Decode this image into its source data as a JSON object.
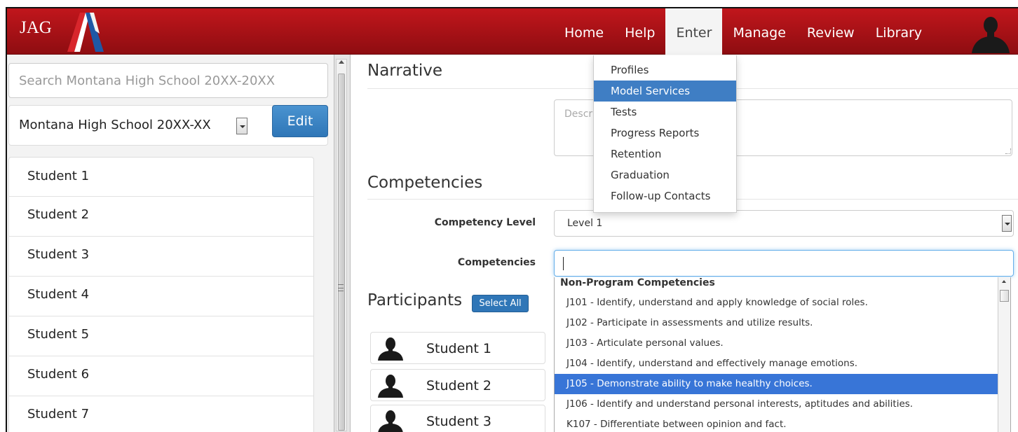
{
  "header": {
    "brand": "JAG",
    "nav": [
      {
        "label": "Home",
        "active": false
      },
      {
        "label": "Help",
        "active": false
      },
      {
        "label": "Enter",
        "active": true
      },
      {
        "label": "Manage",
        "active": false
      },
      {
        "label": "Review",
        "active": false
      },
      {
        "label": "Library",
        "active": false
      }
    ],
    "colors": {
      "bar": "#b3141a",
      "logo_blue": "#1f58a6",
      "logo_red": "#d8262c"
    }
  },
  "enter_menu": {
    "items": [
      {
        "label": "Profiles",
        "active": false
      },
      {
        "label": "Model Services",
        "active": true
      },
      {
        "label": "Tests",
        "active": false
      },
      {
        "label": "Progress Reports",
        "active": false
      },
      {
        "label": "Retention",
        "active": false
      },
      {
        "label": "Graduation",
        "active": false
      },
      {
        "label": "Follow-up Contacts",
        "active": false
      }
    ]
  },
  "left_panel": {
    "search_placeholder": "Search Montana High School 20XX-20XX",
    "school_select": "Montana High School 20XX-XX",
    "edit_label": "Edit",
    "students": [
      "Student 1",
      "Student 2",
      "Student 3",
      "Student 4",
      "Student 5",
      "Student 6",
      "Student 7"
    ]
  },
  "main": {
    "narrative": {
      "title": "Narrative",
      "textarea_placeholder": "Describe the activity"
    },
    "competencies": {
      "title": "Competencies",
      "level_label": "Competency Level",
      "level_value": "Level 1",
      "input_label": "Competencies",
      "input_value": "",
      "dropdown": {
        "group": "Non-Program Competencies",
        "options": [
          {
            "label": "J101 - Identify, understand and apply knowledge of social roles.",
            "highlighted": false
          },
          {
            "label": "J102 - Participate in assessments and utilize results.",
            "highlighted": false
          },
          {
            "label": "J103 - Articulate personal values.",
            "highlighted": false
          },
          {
            "label": "J104 - Identify, understand and effectively manage emotions.",
            "highlighted": false
          },
          {
            "label": "J105 - Demonstrate ability to make healthy choices.",
            "highlighted": true
          },
          {
            "label": "J106 - Identify and understand personal interests, aptitudes and abilities.",
            "highlighted": false
          },
          {
            "label": "K107 - Differentiate between opinion and fact.",
            "highlighted": false
          }
        ]
      }
    },
    "participants": {
      "title": "Participants",
      "select_all_label": "Select All",
      "items": [
        "Student 1",
        "Student 2",
        "Student 3"
      ]
    }
  }
}
